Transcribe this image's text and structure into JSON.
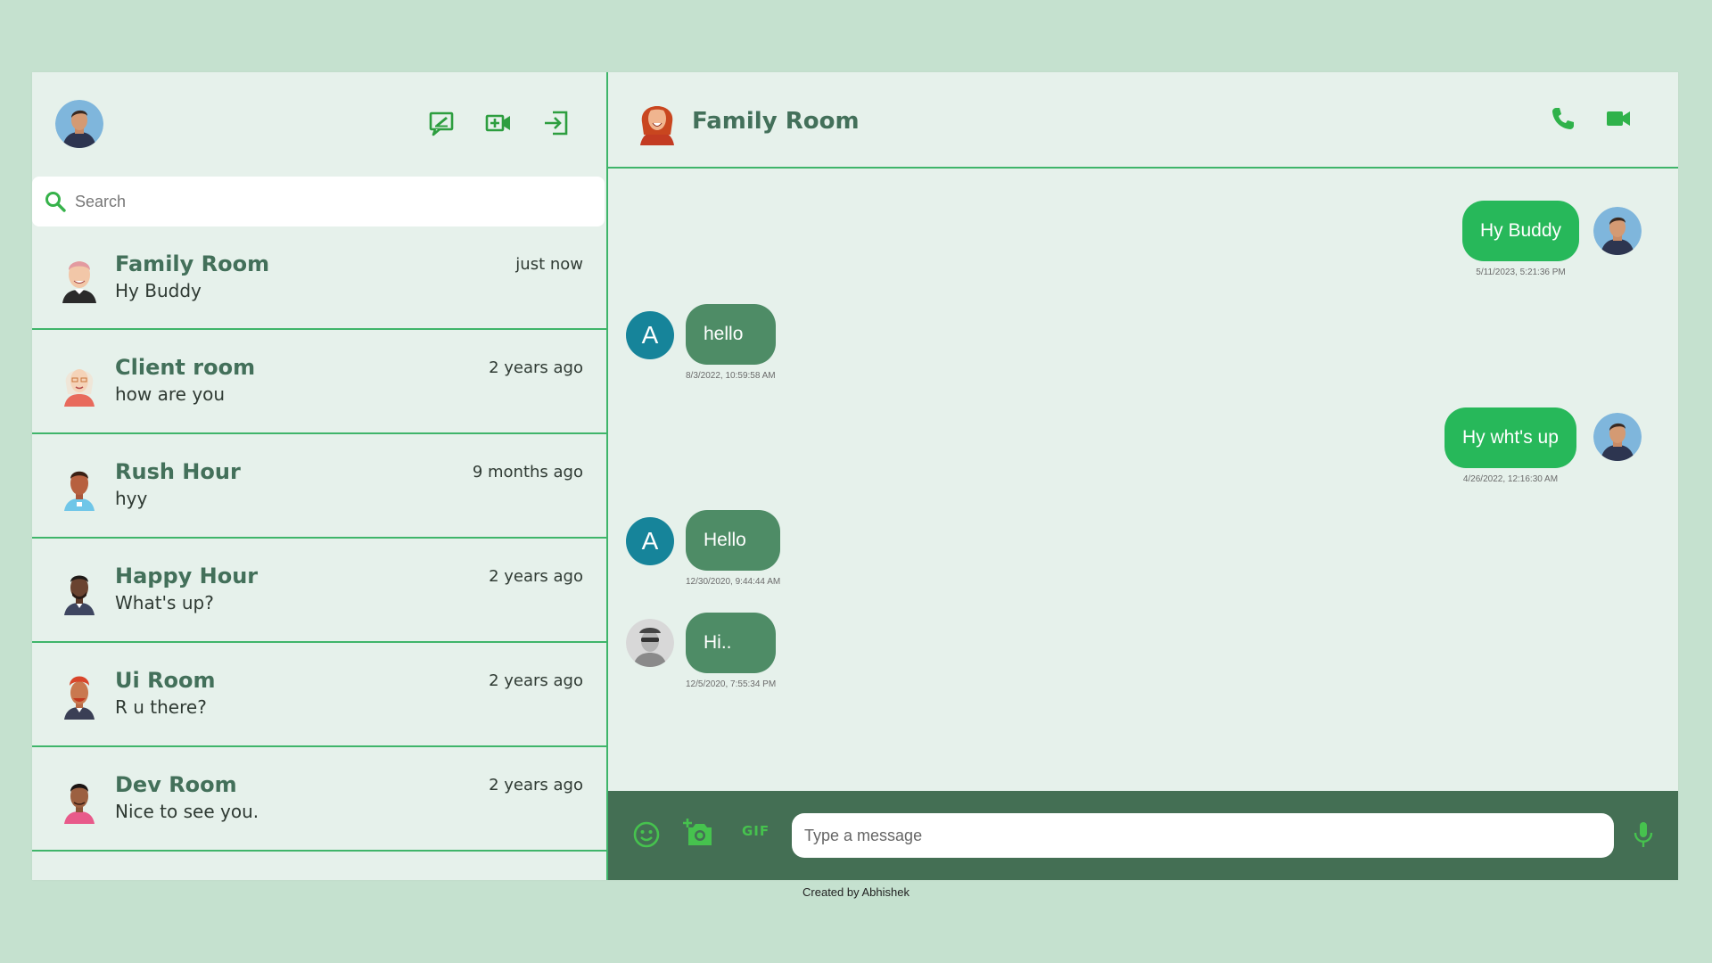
{
  "sidebar": {
    "icons": [
      "new-chat-icon",
      "video-add-icon",
      "logout-icon"
    ],
    "search": {
      "placeholder": "Search",
      "value": ""
    },
    "rooms": [
      {
        "name": "Family Room",
        "last": "Hy Buddy",
        "time": "just now"
      },
      {
        "name": "Client room",
        "last": "how are you",
        "time": "2 years ago"
      },
      {
        "name": "Rush Hour",
        "last": "hyy",
        "time": "9 months ago"
      },
      {
        "name": "Happy Hour",
        "last": "What's up?",
        "time": "2 years ago"
      },
      {
        "name": "Ui Room",
        "last": "R u there?",
        "time": "2 years ago"
      },
      {
        "name": "Dev Room",
        "last": "Nice to see you.",
        "time": "2 years ago"
      }
    ]
  },
  "chat": {
    "title": "Family Room",
    "actions": [
      "phone-icon",
      "video-icon"
    ],
    "messages": [
      {
        "text": "Hy Buddy",
        "time": "5/11/2023, 5:21:36 PM",
        "direction": "out"
      },
      {
        "text": "hello",
        "time": "8/3/2022, 10:59:58 AM",
        "direction": "in",
        "avatar_letter": "A"
      },
      {
        "text": "Hy wht's up",
        "time": "4/26/2022, 12:16:30 AM",
        "direction": "out"
      },
      {
        "text": "Hello",
        "time": "12/30/2020, 9:44:44 AM",
        "direction": "in",
        "avatar_letter": "A"
      },
      {
        "text": "Hi..",
        "time": "12/5/2020, 7:55:34 PM",
        "direction": "in"
      }
    ],
    "composer": {
      "placeholder": "Type a message",
      "value": "",
      "gif_label": "GIF",
      "icons": [
        "emoji-icon",
        "camera-add-icon",
        "gif-icon",
        "microphone-icon"
      ]
    }
  },
  "footer": {
    "credit": "Created by Abhishek"
  },
  "colors": {
    "background": "#c5e1cf",
    "panel": "#e6f1eb",
    "accent": "#3fb56a",
    "outgoing_bubble": "#27b85a",
    "incoming_bubble": "#4e8c66",
    "composer_bar": "#446f54",
    "title_text": "#43705a"
  }
}
